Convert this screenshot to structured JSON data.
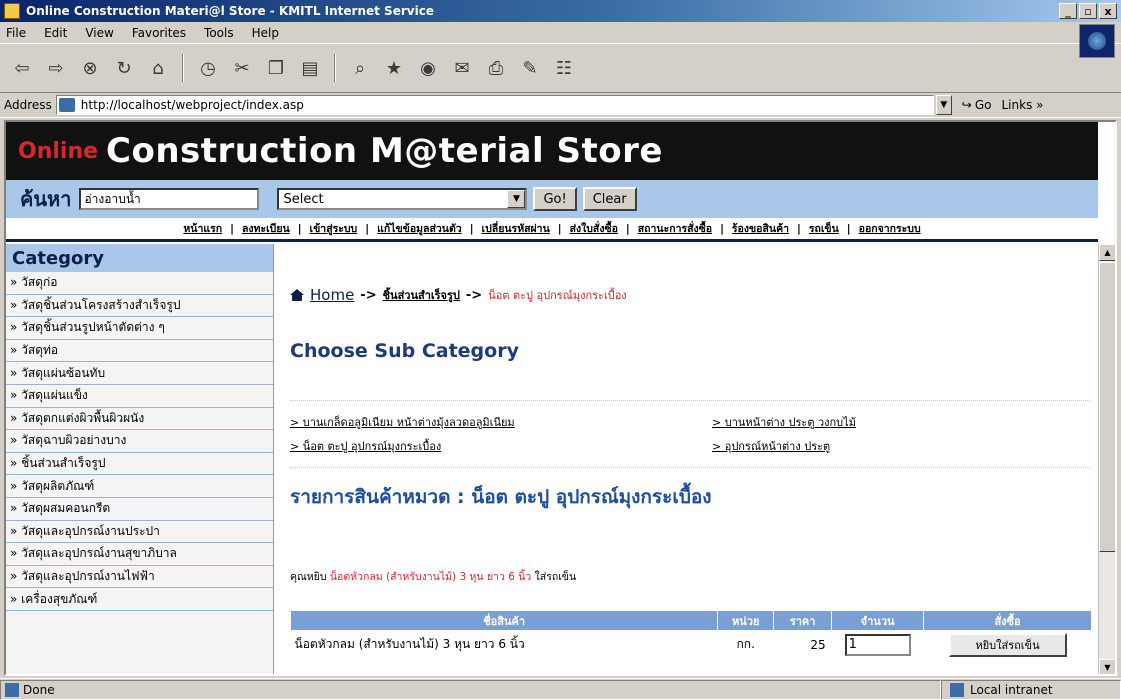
{
  "window": {
    "title": "Online Construction Materi@l Store - KMITL Internet Service",
    "controls": [
      "_",
      "▫",
      "x"
    ]
  },
  "menu": [
    "File",
    "Edit",
    "View",
    "Favorites",
    "Tools",
    "Help"
  ],
  "toolbar_icons": [
    "back-icon",
    "forward-icon",
    "stop-icon",
    "refresh-icon",
    "home-icon",
    "history-icon",
    "cut-icon",
    "copy-icon",
    "paste-icon",
    "search-icon",
    "favorites-icon",
    "media-icon",
    "mail-icon",
    "print-icon",
    "edit-icon",
    "discuss-icon"
  ],
  "address": {
    "label": "Address",
    "url": "http://localhost/webproject/index.asp",
    "go_label": "Go",
    "links_label": "Links »"
  },
  "site": {
    "online_label": "Online",
    "title": "Construction M@terial Store"
  },
  "search": {
    "label": "ค้นหา",
    "value": "อ่างอาบน้ำ",
    "select_value": "Select",
    "go_button": "Go!",
    "clear_button": "Clear"
  },
  "nav": [
    "หน้าแรก",
    "ลงทะเบียน",
    "เข้าสู่ระบบ",
    "แก้ไขข้อมูลส่วนตัว",
    "เปลี่ยนรหัสผ่าน",
    "ส่งใบสั่งซื้อ",
    "สถานะการสั่งซื้อ",
    "ร้องขอสินค้า",
    "รถเข็น",
    "ออกจากระบบ"
  ],
  "sidebar": {
    "header": "Category",
    "items": [
      "» วัสดุก่อ",
      "» วัสดุชิ้นส่วนโครงสร้างสำเร็จรูป",
      "» วัสดุชิ้นส่วนรูปหน้าตัดต่าง ๆ",
      "» วัสดุท่อ",
      "» วัสดุแผ่นซ้อนทับ",
      "» วัสดุแผ่นแข็ง",
      "» วัสดุตกแต่งผิวพื้นผิวผนัง",
      "» วัสดุฉาบผิวอย่างบาง",
      "» ชิ้นส่วนสำเร็จรูป",
      "» วัสดุผลิตภัณฑ์",
      "» วัสดุผสมคอนกรีต",
      "» วัสดุและอุปกรณ์งานประปา",
      "» วัสดุและอุปกรณ์งานสุขาภิบาล",
      "» วัสดุและอุปกรณ์งานไฟฟ้า",
      "» เครื่องสุขภัณฑ์"
    ]
  },
  "breadcrumb": {
    "home": "Home",
    "arrow1": "->",
    "level1": "ชิ้นส่วนสำเร็จรูป",
    "arrow2": "->",
    "current": "น็อต ตะปู อุปกรณ์มุงกระเบื้อง"
  },
  "sub_category": {
    "title": "Choose Sub Category",
    "links": [
      "> บานเกล็ดอลูมิเนียม หน้าต่างมุ้งลวดอลูมิเนียม",
      "> บานหน้าต่าง ประตู วงกบไม้",
      "> น็อต ตะปู อุปกรณ์มุงกระเบื้อง",
      "> อุปกรณ์หน้าต่าง ประตู"
    ]
  },
  "product_list": {
    "title": "รายการสินค้าหมวด : น็อต ตะปู อุปกรณ์มุงกระเบื้อง",
    "cart_note_prefix": "คุณหยิบ",
    "cart_note_item": "น็อตหัวกลม (สำหรับงานไม้) 3 หุน ยาว 6 นิ้ว",
    "cart_note_suffix": "ใส่รถเข็น",
    "columns": [
      "ชื่อสินค้า",
      "หน่วย",
      "ราคา",
      "จำนวน",
      "สั่งซื้อ"
    ],
    "rows": [
      {
        "name": "น็อตหัวกลม (สำหรับงานไม้) 3 หุน ยาว 6 นิ้ว",
        "unit": "กก.",
        "price": "25",
        "qty": "1",
        "button": "หยิบใส่รถเข็น"
      }
    ]
  },
  "status": {
    "left": "Done",
    "zone": "Local intranet"
  }
}
